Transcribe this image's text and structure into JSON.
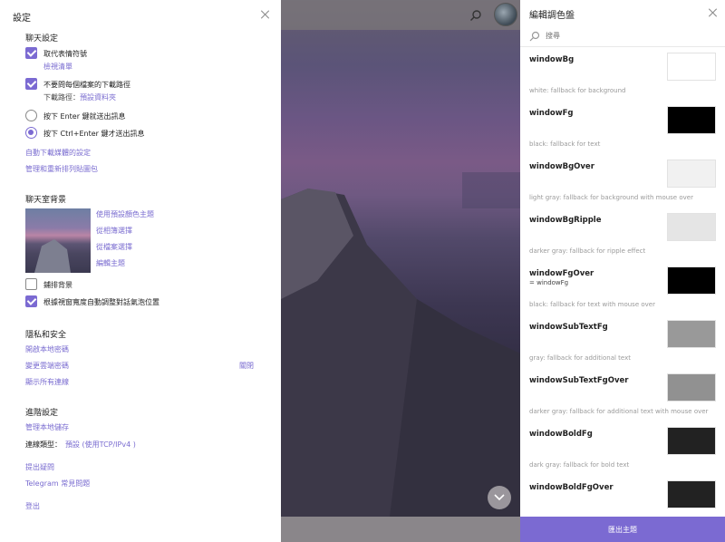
{
  "settings": {
    "title": "設定",
    "chat": {
      "heading": "聊天設定",
      "replace_emoji": "取代表情符號",
      "view_list": "檢視清單",
      "no_ask_path": "不要問每個檔案的下載路徑",
      "download_path_label": "下載路徑：",
      "download_path_value": "預設資料夾",
      "send_enter": "按下 Enter 鍵就送出訊息",
      "send_ctrl_enter": "按下 Ctrl+Enter 鍵才送出訊息",
      "auto_download": "自動下載媒體的設定",
      "manage_stickers": "管理和重新排列貼圖包"
    },
    "background": {
      "heading": "聊天室背景",
      "use_default": "使用預設顏色主題",
      "from_gallery": "從相簿選擇",
      "from_file": "從檔案選擇",
      "edit_theme": "編輯主題",
      "tile": "鋪排背景",
      "adaptive": "根據視窗寬度自動調整對話氣泡位置"
    },
    "privacy": {
      "heading": "隱私和安全",
      "local_passcode": "開啟本地密碼",
      "cloud_password": "變更雲端密碼",
      "cloud_off": "關閉",
      "show_sessions": "顯示所有連線"
    },
    "advanced": {
      "heading": "進階設定",
      "local_storage": "管理本地儲存",
      "conn_label": "連線類型：",
      "conn_value": "預設 (使用TCP/IPv4 )",
      "ask_question": "提出疑問",
      "faq": "Telegram 常見問題",
      "logout": "登出"
    }
  },
  "palette": {
    "title": "編輯調色盤",
    "search_placeholder": "搜尋",
    "export": "匯出主題",
    "items": [
      {
        "name": "windowBg",
        "sub": "",
        "desc": "white: fallback for background",
        "color": "#ffffff"
      },
      {
        "name": "windowFg",
        "sub": "",
        "desc": "black: fallback for text",
        "color": "#000000"
      },
      {
        "name": "windowBgOver",
        "sub": "",
        "desc": "light gray: fallback for background with mouse over",
        "color": "#f1f1f1"
      },
      {
        "name": "windowBgRipple",
        "sub": "",
        "desc": "darker gray: fallback for ripple effect",
        "color": "#e5e5e5"
      },
      {
        "name": "windowFgOver",
        "sub": "= windowFg",
        "desc": "black: fallback for text with mouse over",
        "color": "#000000"
      },
      {
        "name": "windowSubTextFg",
        "sub": "",
        "desc": "gray: fallback for additional text",
        "color": "#999999"
      },
      {
        "name": "windowSubTextFgOver",
        "sub": "",
        "desc": "darker gray: fallback for additional text with mouse over",
        "color": "#919191"
      },
      {
        "name": "windowBoldFg",
        "sub": "",
        "desc": "dark gray: fallback for bold text",
        "color": "#222222"
      },
      {
        "name": "windowBoldFgOver",
        "sub": "",
        "desc": "",
        "color": "#222222"
      }
    ]
  }
}
